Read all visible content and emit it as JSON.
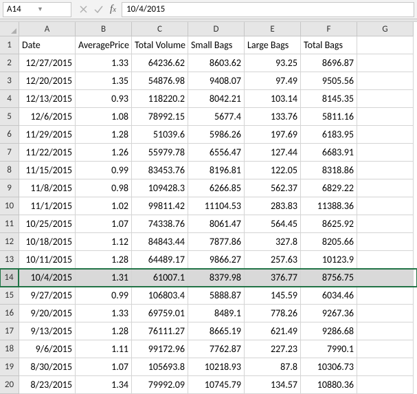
{
  "nameBox": "A14",
  "formulaValue": "10/4/2015",
  "columns": [
    "A",
    "B",
    "C",
    "D",
    "E",
    "F",
    "G"
  ],
  "headerRow": [
    "Date",
    "AveragePrice",
    "Total Volume",
    "Small Bags",
    "Large Bags",
    "Total Bags",
    ""
  ],
  "selectedRowIndex": 14,
  "rows": [
    {
      "n": 1,
      "c": [
        "Date",
        "AveragePrice",
        "Total Volume",
        "Small Bags",
        "Large Bags",
        "Total Bags",
        ""
      ]
    },
    {
      "n": 2,
      "c": [
        "12/27/2015",
        "1.33",
        "64236.62",
        "8603.62",
        "93.25",
        "8696.87",
        ""
      ]
    },
    {
      "n": 3,
      "c": [
        "12/20/2015",
        "1.35",
        "54876.98",
        "9408.07",
        "97.49",
        "9505.56",
        ""
      ]
    },
    {
      "n": 4,
      "c": [
        "12/13/2015",
        "0.93",
        "118220.2",
        "8042.21",
        "103.14",
        "8145.35",
        ""
      ]
    },
    {
      "n": 5,
      "c": [
        "12/6/2015",
        "1.08",
        "78992.15",
        "5677.4",
        "133.76",
        "5811.16",
        ""
      ]
    },
    {
      "n": 6,
      "c": [
        "11/29/2015",
        "1.28",
        "51039.6",
        "5986.26",
        "197.69",
        "6183.95",
        ""
      ]
    },
    {
      "n": 7,
      "c": [
        "11/22/2015",
        "1.26",
        "55979.78",
        "6556.47",
        "127.44",
        "6683.91",
        ""
      ]
    },
    {
      "n": 8,
      "c": [
        "11/15/2015",
        "0.99",
        "83453.76",
        "8196.81",
        "122.05",
        "8318.86",
        ""
      ]
    },
    {
      "n": 9,
      "c": [
        "11/8/2015",
        "0.98",
        "109428.3",
        "6266.85",
        "562.37",
        "6829.22",
        ""
      ]
    },
    {
      "n": 10,
      "c": [
        "11/1/2015",
        "1.02",
        "99811.42",
        "11104.53",
        "283.83",
        "11388.36",
        ""
      ]
    },
    {
      "n": 11,
      "c": [
        "10/25/2015",
        "1.07",
        "74338.76",
        "8061.47",
        "564.45",
        "8625.92",
        ""
      ]
    },
    {
      "n": 12,
      "c": [
        "10/18/2015",
        "1.12",
        "84843.44",
        "7877.86",
        "327.8",
        "8205.66",
        ""
      ]
    },
    {
      "n": 13,
      "c": [
        "10/11/2015",
        "1.28",
        "64489.17",
        "9866.27",
        "257.63",
        "10123.9",
        ""
      ]
    },
    {
      "n": 14,
      "c": [
        "10/4/2015",
        "1.31",
        "61007.1",
        "8379.98",
        "376.77",
        "8756.75",
        ""
      ]
    },
    {
      "n": 15,
      "c": [
        "9/27/2015",
        "0.99",
        "106803.4",
        "5888.87",
        "145.59",
        "6034.46",
        ""
      ]
    },
    {
      "n": 16,
      "c": [
        "9/20/2015",
        "1.33",
        "69759.01",
        "8489.1",
        "778.26",
        "9267.36",
        ""
      ]
    },
    {
      "n": 17,
      "c": [
        "9/13/2015",
        "1.28",
        "76111.27",
        "8665.19",
        "621.49",
        "9286.68",
        ""
      ]
    },
    {
      "n": 18,
      "c": [
        "9/6/2015",
        "1.11",
        "99172.96",
        "7762.87",
        "227.23",
        "7990.1",
        ""
      ]
    },
    {
      "n": 19,
      "c": [
        "8/30/2015",
        "1.07",
        "105693.8",
        "10218.93",
        "87.8",
        "10306.73",
        ""
      ]
    },
    {
      "n": 20,
      "c": [
        "8/23/2015",
        "1.34",
        "79992.09",
        "10745.79",
        "134.57",
        "10880.36",
        ""
      ]
    }
  ],
  "chart_data": {
    "type": "table",
    "title": "",
    "columns": [
      "Date",
      "AveragePrice",
      "Total Volume",
      "Small Bags",
      "Large Bags",
      "Total Bags"
    ],
    "rows": [
      [
        "12/27/2015",
        1.33,
        64236.62,
        8603.62,
        93.25,
        8696.87
      ],
      [
        "12/20/2015",
        1.35,
        54876.98,
        9408.07,
        97.49,
        9505.56
      ],
      [
        "12/13/2015",
        0.93,
        118220.2,
        8042.21,
        103.14,
        8145.35
      ],
      [
        "12/6/2015",
        1.08,
        78992.15,
        5677.4,
        133.76,
        5811.16
      ],
      [
        "11/29/2015",
        1.28,
        51039.6,
        5986.26,
        197.69,
        6183.95
      ],
      [
        "11/22/2015",
        1.26,
        55979.78,
        6556.47,
        127.44,
        6683.91
      ],
      [
        "11/15/2015",
        0.99,
        83453.76,
        8196.81,
        122.05,
        8318.86
      ],
      [
        "11/8/2015",
        0.98,
        109428.3,
        6266.85,
        562.37,
        6829.22
      ],
      [
        "11/1/2015",
        1.02,
        99811.42,
        11104.53,
        283.83,
        11388.36
      ],
      [
        "10/25/2015",
        1.07,
        74338.76,
        8061.47,
        564.45,
        8625.92
      ],
      [
        "10/18/2015",
        1.12,
        84843.44,
        7877.86,
        327.8,
        8205.66
      ],
      [
        "10/11/2015",
        1.28,
        64489.17,
        9866.27,
        257.63,
        10123.9
      ],
      [
        "10/4/2015",
        1.31,
        61007.1,
        8379.98,
        376.77,
        8756.75
      ],
      [
        "9/27/2015",
        0.99,
        106803.4,
        5888.87,
        145.59,
        6034.46
      ],
      [
        "9/20/2015",
        1.33,
        69759.01,
        8489.1,
        778.26,
        9267.36
      ],
      [
        "9/13/2015",
        1.28,
        76111.27,
        8665.19,
        621.49,
        9286.68
      ],
      [
        "9/6/2015",
        1.11,
        99172.96,
        7762.87,
        227.23,
        7990.1
      ],
      [
        "8/30/2015",
        1.07,
        105693.8,
        10218.93,
        87.8,
        10306.73
      ],
      [
        "8/23/2015",
        1.34,
        79992.09,
        10745.79,
        134.57,
        10880.36
      ]
    ]
  }
}
